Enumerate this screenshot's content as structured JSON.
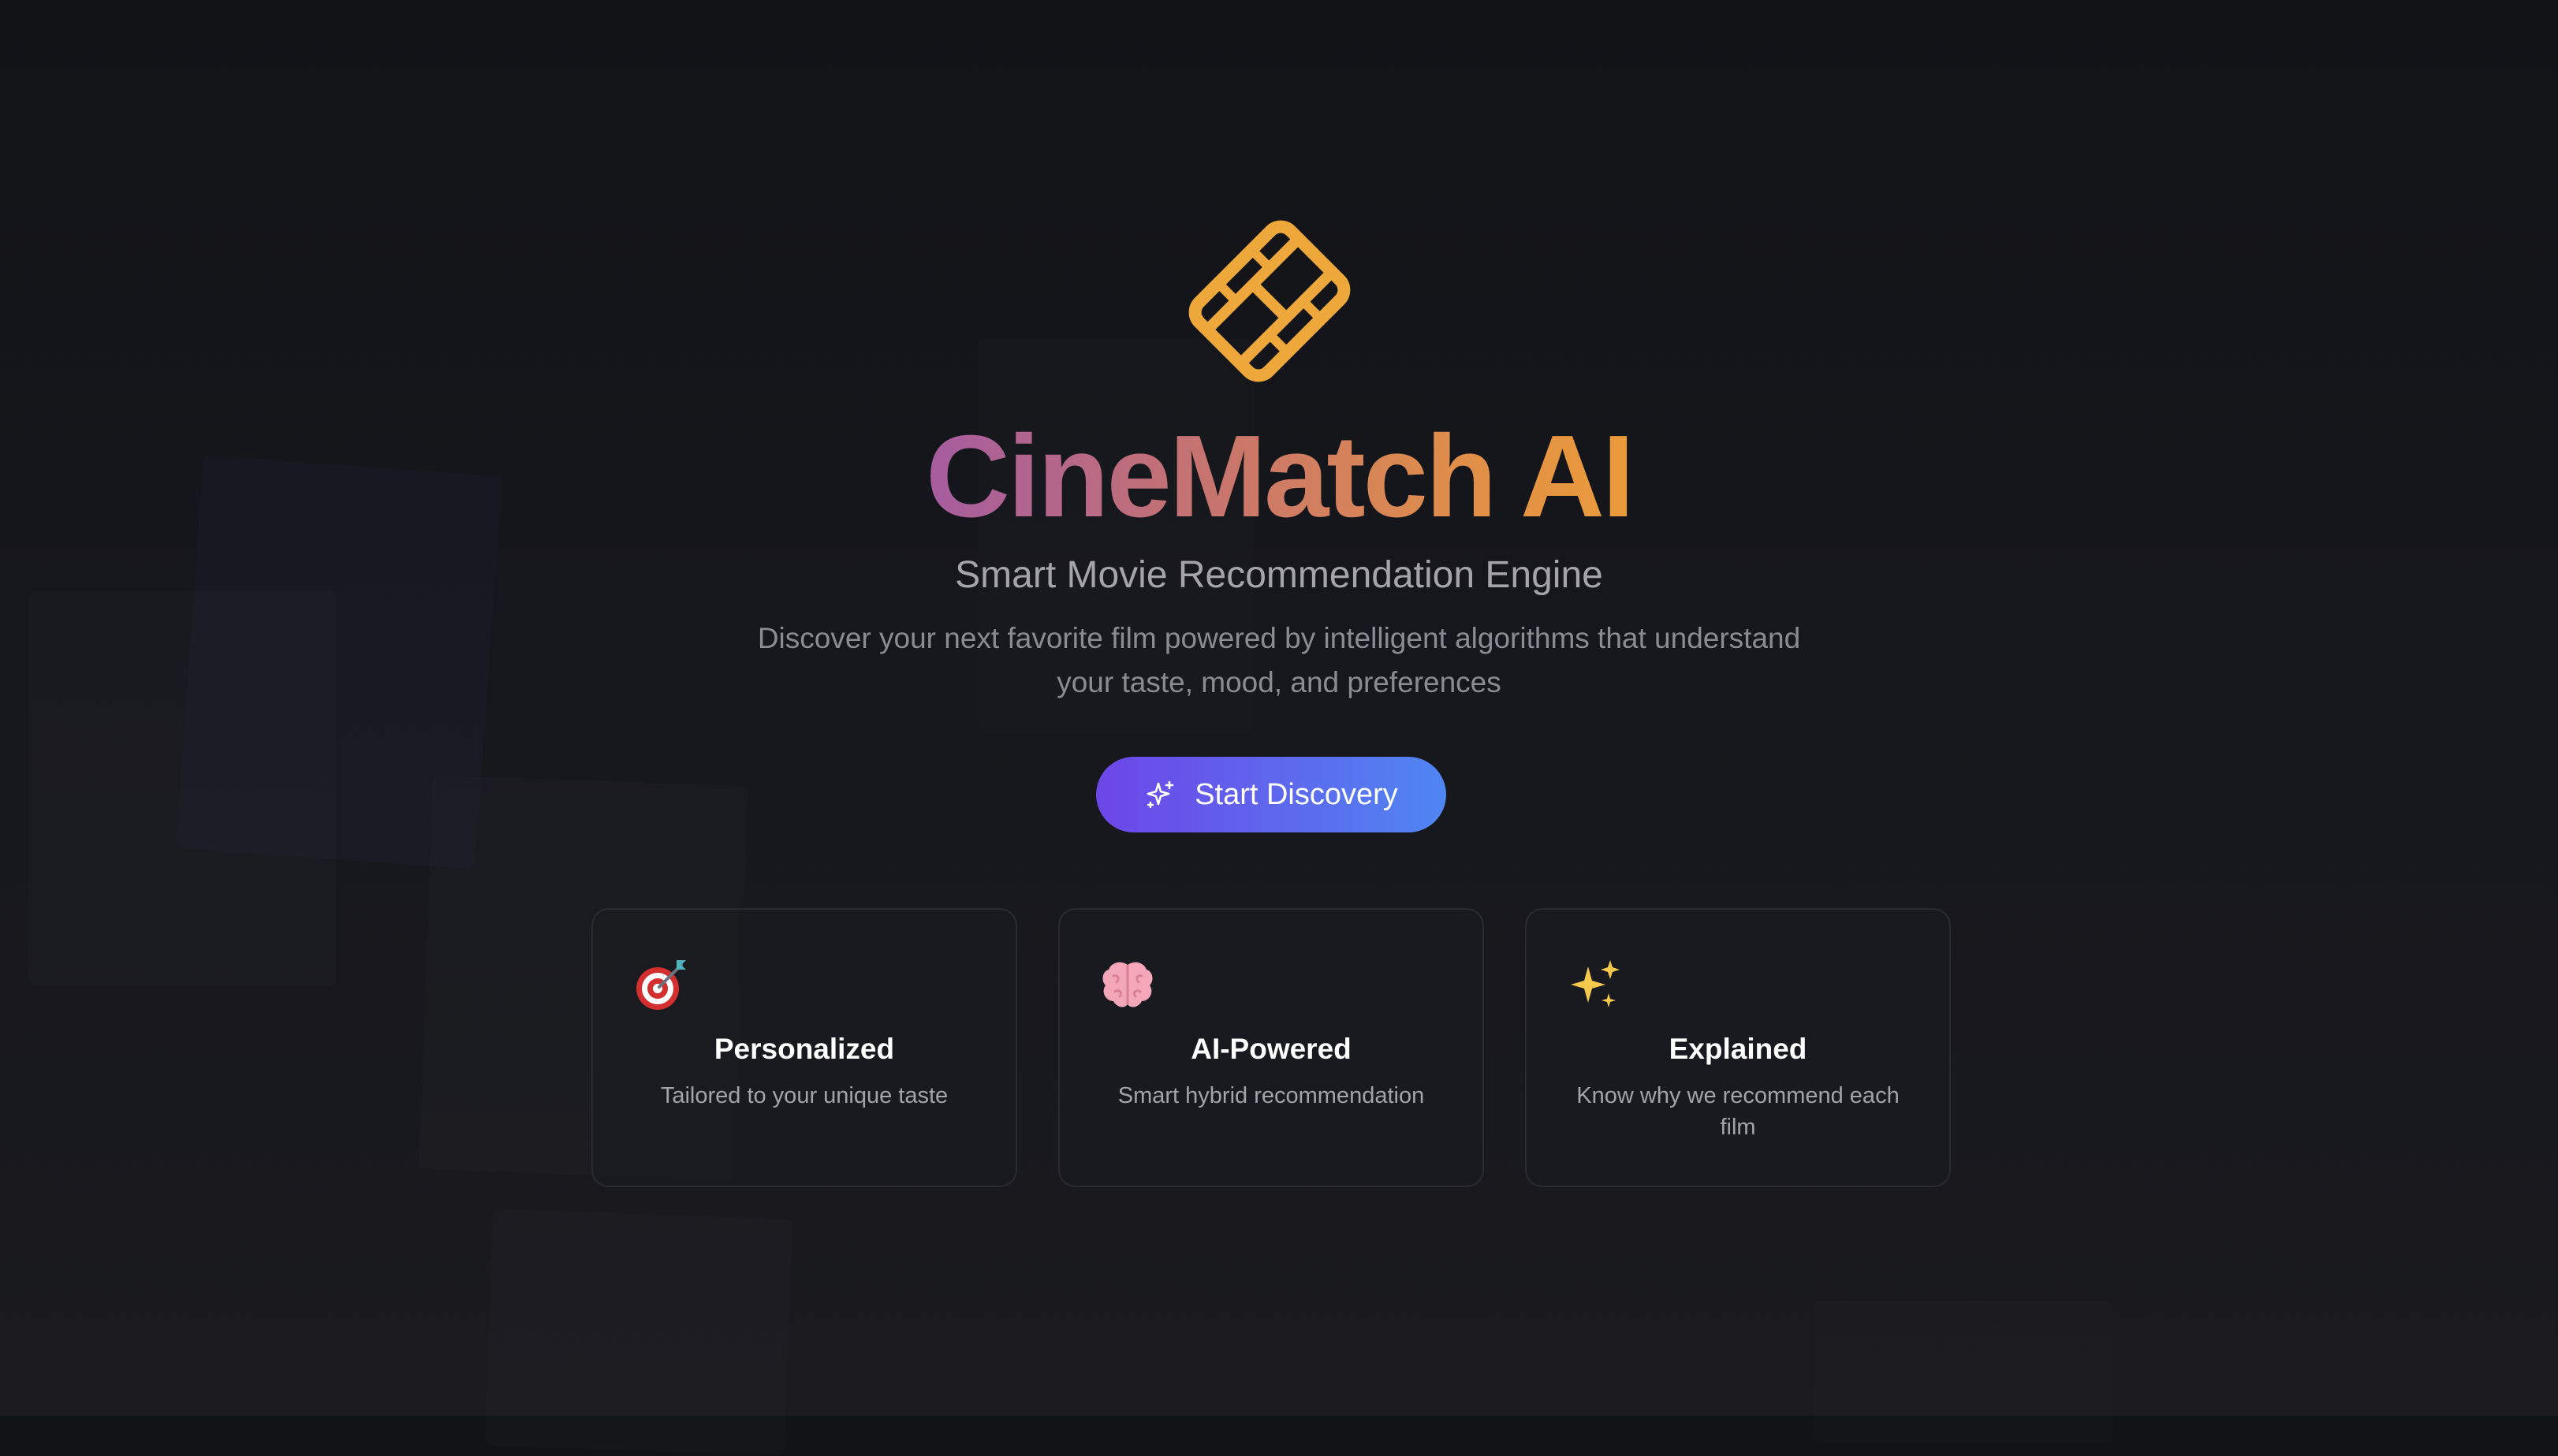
{
  "app": {
    "title": "CineMatch AI",
    "subtitle": "Smart Movie Recommendation Engine",
    "description": "Discover your next favorite film powered by intelligent algorithms that understand your taste, mood, and preferences",
    "logo_icon": "film-reel-icon"
  },
  "cta": {
    "label": "Start Discovery",
    "icon": "sparkles-icon"
  },
  "features": [
    {
      "icon": "target-icon",
      "title": "Personalized",
      "text": "Tailored to your unique taste"
    },
    {
      "icon": "brain-icon",
      "title": "AI-Powered",
      "text": "Smart hybrid recommendation"
    },
    {
      "icon": "sparkles-icon",
      "title": "Explained",
      "text": "Know why we recommend each film"
    }
  ],
  "colors": {
    "background": "#131418",
    "logo": "#EDA73A",
    "title_gradient_start": "#A65CA0",
    "title_gradient_end": "#EB9B3A",
    "button_gradient_start": "#6D46E8",
    "button_gradient_end": "#4F86F2",
    "card_border": "#2A2B31"
  }
}
